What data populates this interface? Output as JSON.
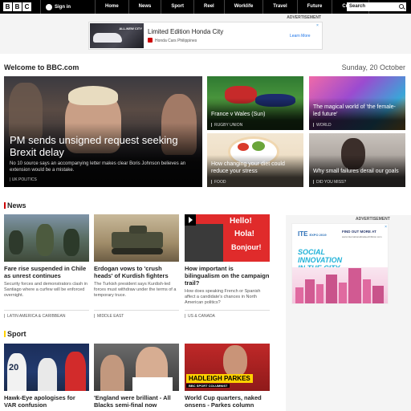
{
  "nav": {
    "logo_letters": [
      "B",
      "B",
      "C"
    ],
    "signin_label": "Sign in",
    "items": [
      "Home",
      "News",
      "Sport",
      "Reel",
      "Worklife",
      "Travel",
      "Future",
      "Culture"
    ],
    "more_label": "More",
    "search_placeholder": "Search"
  },
  "top_ad": {
    "label": "ADVERTISEMENT",
    "car_label": "ALL-NEW CITY",
    "title": "Limited Edition Honda City",
    "advertiser": "Honda Cars Philippines",
    "cta": "Learn More",
    "close": "×"
  },
  "welcome": {
    "title": "Welcome to BBC.com",
    "date": "Sunday, 20 October"
  },
  "hero": {
    "headline": "PM sends unsigned request seeking Brexit delay",
    "summary": "No 10 source says an accompanying letter makes clear Boris Johnson believes an extension would be a mistake.",
    "tag": "UK POLITICS"
  },
  "tiles": [
    {
      "title": "France v Wales (Sun)",
      "tag": "RUGBY UNION"
    },
    {
      "title": "The magical world of 'the female-led future'",
      "tag": "WORLD"
    },
    {
      "title": "How changing your diet could reduce your stress",
      "tag": "FOOD"
    },
    {
      "title": "Why small failures derail our goals",
      "tag": "DID YOU MISS?"
    }
  ],
  "sections": {
    "news": "News",
    "sport": "Sport"
  },
  "news_cards": [
    {
      "headline": "Fare rise suspended in Chile as unrest continues",
      "summary": "Security forces and demonstrators clash in Santiago where a curfew will be enforced overnight.",
      "tag": "LATIN AMERICA & CARIBBEAN"
    },
    {
      "headline": "Erdogan vows to 'crush heads' of Kurdish fighters",
      "summary": "The Turkish president says Kurdish-led forces must withdraw under the terms of a temporary truce.",
      "tag": "MIDDLE EAST"
    },
    {
      "headline": "How important is bilingualism on the campaign trail?",
      "summary": "How does speaking French or Spanish affect a candidate's chances in North American politics?",
      "tag": "US & CANADA",
      "bubbles": [
        "Hello!",
        "Hola!",
        "Bonjour!"
      ]
    }
  ],
  "side_ad": {
    "label": "ADVERTISEMENT",
    "ite": "ITE",
    "ite_small": "EXPO 2019",
    "find": "FIND OUT MORE AT",
    "site": "www.internationaltradeexhibition.com",
    "line1": "SOCIAL",
    "line2": "INNOVATION",
    "line3": "IN THE CITY",
    "close": "×"
  },
  "sport_cards": [
    {
      "headline": "Hawk-Eye apologises for VAR confusion",
      "jersey": "20"
    },
    {
      "headline": "'England were brilliant - All Blacks semi-final now"
    },
    {
      "headline": "World Cup quarters, naked onsens - Parkes column",
      "caption_name": "HADLEIGH PARKES",
      "caption_sub": "BBC SPORT COLUMNIST"
    }
  ]
}
